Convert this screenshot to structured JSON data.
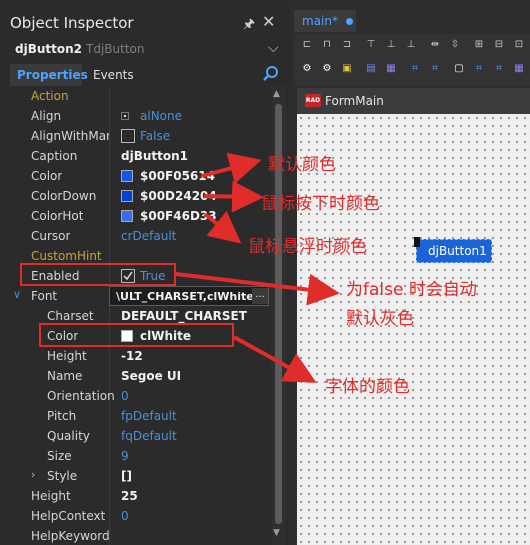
{
  "inspector": {
    "title": "Object Inspector",
    "pin_glyph": "🖈",
    "close_glyph": "✕",
    "component": {
      "name": "djButton2",
      "type": "TdjButton"
    },
    "tabs": {
      "properties": "Properties",
      "events": "Events"
    },
    "properties": [
      {
        "name": "Action",
        "value": "",
        "category": true
      },
      {
        "name": "Align",
        "value": "alNone"
      },
      {
        "name": "AlignWithMarg",
        "value": "False"
      },
      {
        "name": "Caption",
        "value": "djButton1"
      },
      {
        "name": "Color",
        "value": "$00F05614",
        "swatch": "#1456f0"
      },
      {
        "name": "ColorDown",
        "value": "$00D24204",
        "swatch": "#0442d2"
      },
      {
        "name": "ColorHot",
        "value": "$00F46D33",
        "swatch": "#336df4"
      },
      {
        "name": "Cursor",
        "value": "crDefault"
      },
      {
        "name": "CustomHint",
        "value": "",
        "category": true
      },
      {
        "name": "Enabled",
        "value": "True"
      },
      {
        "name": "Font",
        "value": "\\ULT_CHARSET,clWhite,"
      },
      {
        "name": "Charset",
        "value": "DEFAULT_CHARSET"
      },
      {
        "name": "Color",
        "value": "clWhite",
        "swatch": "#ffffff"
      },
      {
        "name": "Height",
        "value": "-12"
      },
      {
        "name": "Name",
        "value": "Segoe UI"
      },
      {
        "name": "Orientation",
        "value": "0"
      },
      {
        "name": "Pitch",
        "value": "fpDefault"
      },
      {
        "name": "Quality",
        "value": "fqDefault"
      },
      {
        "name": "Size",
        "value": "9"
      },
      {
        "name": "Style",
        "value": "[]"
      },
      {
        "name": "Height",
        "value": "25"
      },
      {
        "name": "HelpContext",
        "value": "0"
      },
      {
        "name": "HelpKeyword",
        "value": ""
      }
    ],
    "font_ellipsis": "..."
  },
  "designer": {
    "tab_label": "main*",
    "form_caption": "FormMain",
    "rad_badge": "RAD",
    "button_caption": "djButton1"
  },
  "annotations": {
    "color": "默认颜色",
    "color_down": "鼠标按下时颜色",
    "color_hot": "鼠标悬浮时颜色",
    "enabled_line1": "为false 时会自动",
    "enabled_line2": "默认灰色",
    "font_color": "字体的颜色"
  },
  "colors": {
    "accent": "#4ea3ff",
    "annotation_red": "#e12c2c",
    "category_text": "#c9a13c",
    "button_fill": "#1a63d8"
  }
}
